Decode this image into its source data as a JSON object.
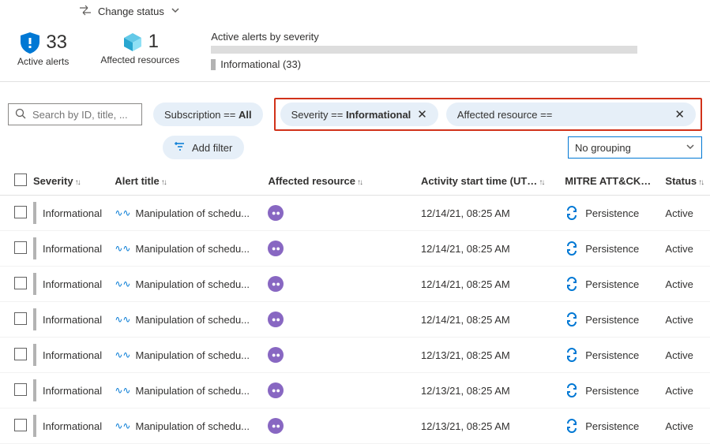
{
  "topbar": {
    "change_status": "Change status"
  },
  "summary": {
    "active_alerts_count": "33",
    "active_alerts_label": "Active alerts",
    "affected_resources_count": "1",
    "affected_resources_label": "Affected resources",
    "severity_title": "Active alerts by severity",
    "breakdown": "Informational (33)"
  },
  "filters": {
    "search_placeholder": "Search by ID, title, ...",
    "subscription_label": "Subscription == ",
    "subscription_value": "All",
    "severity_label": "Severity == ",
    "severity_value": "Informational",
    "affected_label": "Affected resource ==",
    "add_filter": "Add filter",
    "grouping": "No grouping"
  },
  "columns": {
    "severity": "Severity",
    "title": "Alert title",
    "resource": "Affected resource",
    "start": "Activity start time (UT…",
    "mitre": "MITRE ATT&CK…",
    "status": "Status"
  },
  "rows": [
    {
      "severity": "Informational",
      "title": "Manipulation of schedu...",
      "start": "12/14/21, 08:25 AM",
      "mitre": "Persistence",
      "status": "Active"
    },
    {
      "severity": "Informational",
      "title": "Manipulation of schedu...",
      "start": "12/14/21, 08:25 AM",
      "mitre": "Persistence",
      "status": "Active"
    },
    {
      "severity": "Informational",
      "title": "Manipulation of schedu...",
      "start": "12/14/21, 08:25 AM",
      "mitre": "Persistence",
      "status": "Active"
    },
    {
      "severity": "Informational",
      "title": "Manipulation of schedu...",
      "start": "12/14/21, 08:25 AM",
      "mitre": "Persistence",
      "status": "Active"
    },
    {
      "severity": "Informational",
      "title": "Manipulation of schedu...",
      "start": "12/13/21, 08:25 AM",
      "mitre": "Persistence",
      "status": "Active"
    },
    {
      "severity": "Informational",
      "title": "Manipulation of schedu...",
      "start": "12/13/21, 08:25 AM",
      "mitre": "Persistence",
      "status": "Active"
    },
    {
      "severity": "Informational",
      "title": "Manipulation of schedu...",
      "start": "12/13/21, 08:25 AM",
      "mitre": "Persistence",
      "status": "Active"
    }
  ]
}
